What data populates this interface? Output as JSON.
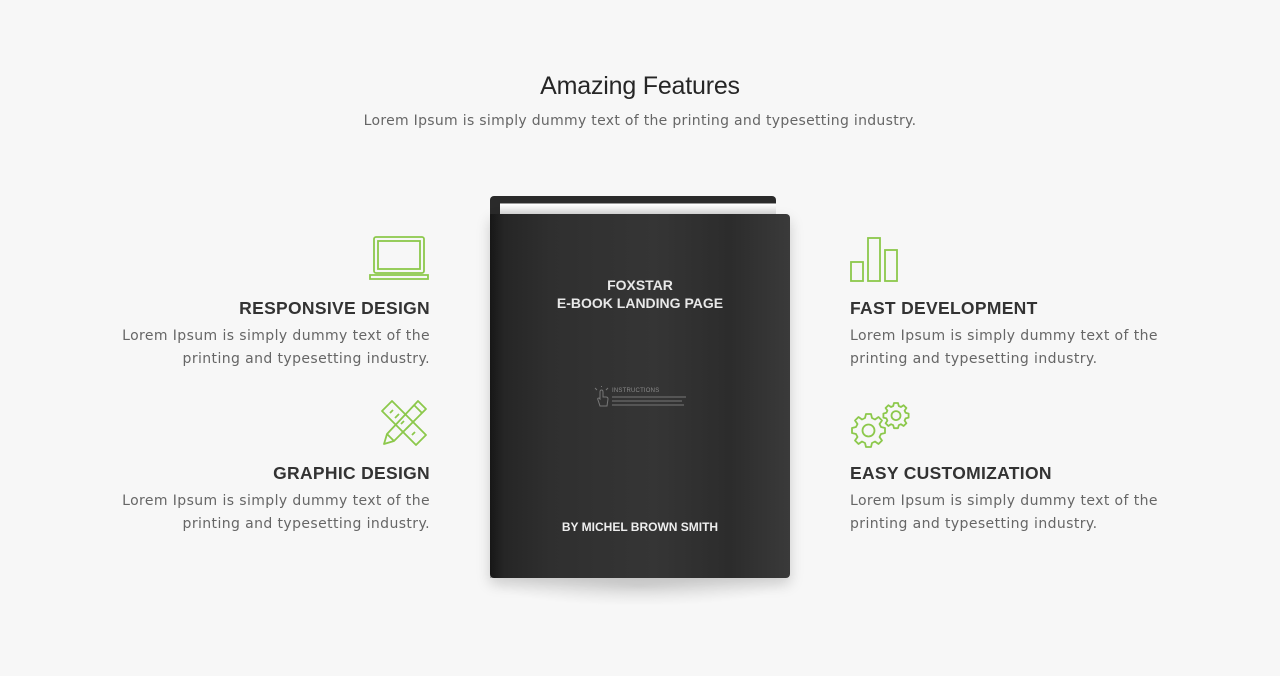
{
  "section": {
    "title": "Amazing Features",
    "subtitle": "Lorem Ipsum is simply dummy text of the printing and typesetting industry."
  },
  "features": {
    "left": [
      {
        "icon": "laptop-icon",
        "title": "RESPONSIVE DESIGN",
        "line1": "Lorem Ipsum is simply dummy text of the",
        "line2": "printing and typesetting industry."
      },
      {
        "icon": "pencil-ruler-icon",
        "title": "GRAPHIC DESIGN",
        "line1": "Lorem Ipsum is simply dummy text of the",
        "line2": "printing and typesetting industry."
      }
    ],
    "right": [
      {
        "icon": "bar-chart-icon",
        "title": "FAST DEVELOPMENT",
        "line1": "Lorem Ipsum is simply dummy text of the",
        "line2": "printing and typesetting industry."
      },
      {
        "icon": "gears-icon",
        "title": "EASY CUSTOMIZATION",
        "line1": "Lorem Ipsum is simply dummy text of the",
        "line2": "printing and typesetting industry."
      }
    ]
  },
  "book": {
    "title_line1": "FOXSTAR",
    "title_line2": "E-BOOK LANDING PAGE",
    "instructions_label": "INSTRUCTIONS",
    "author": "BY MICHEL BROWN SMITH"
  },
  "colors": {
    "accent": "#8cc84b",
    "background": "#f7f7f7",
    "heading": "#262626",
    "body_text": "#666666"
  }
}
